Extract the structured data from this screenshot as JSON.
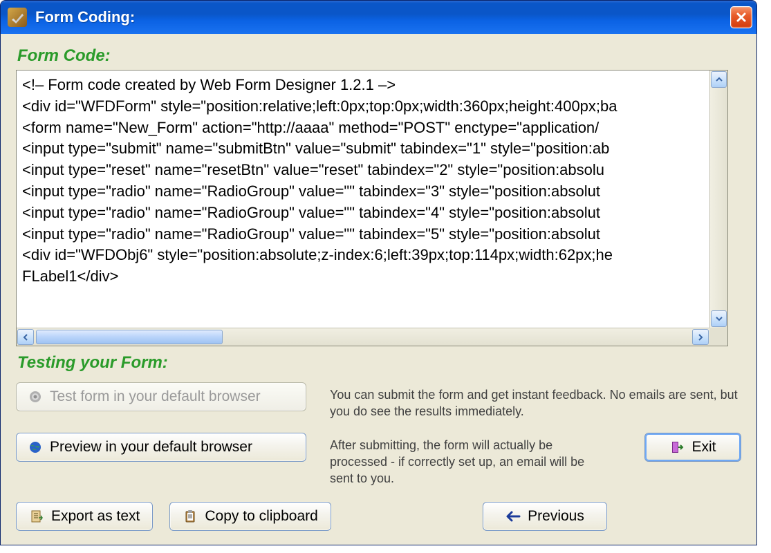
{
  "window": {
    "title": "Form Coding:"
  },
  "sections": {
    "form_code_heading": "Form Code:",
    "testing_heading": "Testing your Form:"
  },
  "code": {
    "lines": [
      "<!– Form code created by Web Form Designer 1.2.1 –>",
      "<div id=\"WFDForm\" style=\"position:relative;left:0px;top:0px;width:360px;height:400px;ba",
      "<form name=\"New_Form\" action=\"http://aaaa\" method=\"POST\" enctype=\"application/",
      "<input type=\"submit\" name=\"submitBtn\" value=\"submit\" tabindex=\"1\" style=\"position:ab",
      "<input type=\"reset\" name=\"resetBtn\" value=\"reset\" tabindex=\"2\" style=\"position:absolu",
      "<input type=\"radio\" name=\"RadioGroup\" value=\"\" tabindex=\"3\" style=\"position:absolut",
      "<input type=\"radio\" name=\"RadioGroup\" value=\"\" tabindex=\"4\" style=\"position:absolut",
      "<input type=\"radio\" name=\"RadioGroup\" value=\"\" tabindex=\"5\" style=\"position:absolut",
      "<div id=\"WFDObj6\" style=\"position:absolute;z-index:6;left:39px;top:114px;width:62px;he",
      "FLabel1</div>"
    ]
  },
  "buttons": {
    "test_browser": "Test form in your default browser",
    "preview_browser": "Preview in your default browser",
    "export_text": "Export as text",
    "copy_clipboard": "Copy to clipboard",
    "previous": "Previous",
    "exit": "Exit"
  },
  "descriptions": {
    "test_desc": "You can submit the form and get instant feedback. No emails are sent, but you do see the results immediately.",
    "preview_desc": "After submitting, the form will actually be processed - if correctly set up, an email will be sent to you."
  }
}
